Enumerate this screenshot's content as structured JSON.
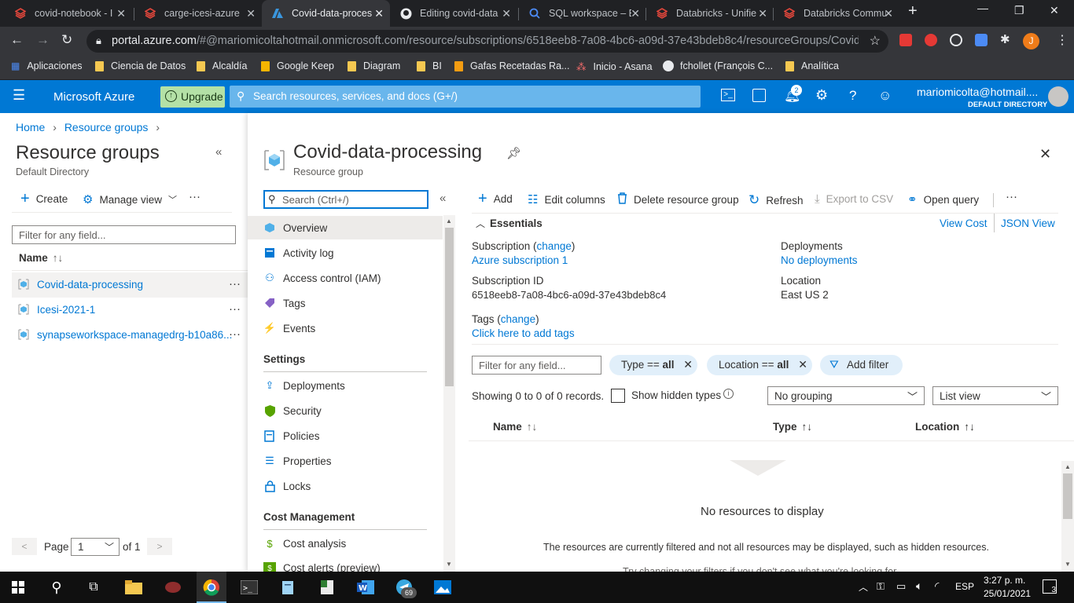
{
  "browser": {
    "tabs": [
      {
        "title": "covid-notebook - I",
        "color": "#e0463b"
      },
      {
        "title": "carge-icesi-azure",
        "color": "#e0463b"
      },
      {
        "title": "Covid-data-proces",
        "color": "#0078d4"
      },
      {
        "title": "Editing covid-data",
        "color": "#ffffff"
      },
      {
        "title": "SQL workspace – E",
        "color": "#4c8bf5"
      },
      {
        "title": "Databricks - Unifie",
        "color": "#e0463b"
      },
      {
        "title": "Databricks Commu",
        "color": "#e0463b"
      }
    ],
    "new_tab": "+",
    "url_host": "portal.azure.com",
    "url_path": "/#@mariomicoltahotmail.onmicrosoft.com/resource/subscriptions/6518eeb8-7a08-4bc6-a09d-37e43bdeb8c4/resourceGroups/Covid-d...",
    "profile_initial": "J",
    "bookmarks": [
      "Aplicaciones",
      "Ciencia de Datos",
      "Alcaldía",
      "Google Keep",
      "Diagram",
      "BI",
      "Gafas Recetadas Ra...",
      "Inicio - Asana",
      "fchollet (François C...",
      "Analítica"
    ]
  },
  "azure": {
    "brand": "Microsoft Azure",
    "upgrade": "Upgrade",
    "search_placeholder": "Search resources, services, and docs (G+/)",
    "notif_count": "2",
    "user": "mariomicolta@hotmail....",
    "directory": "DEFAULT DIRECTORY"
  },
  "breadcrumb": [
    "Home",
    "Resource groups"
  ],
  "left": {
    "title": "Resource groups",
    "subtitle": "Default Directory",
    "create": "Create",
    "manage_view": "Manage view",
    "filter_placeholder": "Filter for any field...",
    "col_name": "Name",
    "groups": [
      "Covid-data-processing",
      "Icesi-2021-1",
      "synapseworkspace-managedrg-b10a86..."
    ],
    "page_label": "Page",
    "page_value": "1",
    "page_of": "of 1"
  },
  "blade": {
    "title": "Covid-data-processing",
    "subtitle": "Resource group",
    "search_placeholder": "Search (Ctrl+/)",
    "menu_top": [
      "Overview",
      "Activity log",
      "Access control (IAM)",
      "Tags",
      "Events"
    ],
    "settings_header": "Settings",
    "menu_settings": [
      "Deployments",
      "Security",
      "Policies",
      "Properties",
      "Locks"
    ],
    "cost_header": "Cost Management",
    "menu_cost": [
      "Cost analysis",
      "Cost alerts (preview)"
    ]
  },
  "toolbar": {
    "add": "Add",
    "edit_columns": "Edit columns",
    "delete": "Delete resource group",
    "refresh": "Refresh",
    "export": "Export to CSV",
    "open_query": "Open query",
    "more": "···"
  },
  "essentials": {
    "header": "Essentials",
    "view_cost": "View Cost",
    "json_view": "JSON View",
    "subscription_label": "Subscription",
    "change": "change",
    "subscription_value": "Azure subscription 1",
    "subscription_id_label": "Subscription ID",
    "subscription_id": "6518eeb8-7a08-4bc6-a09d-37e43bdeb8c4",
    "tags_label": "Tags",
    "tags_value": "Click here to add tags",
    "deployments_label": "Deployments",
    "deployments_value": "No deployments",
    "location_label": "Location",
    "location_value": "East US 2"
  },
  "resources": {
    "filter_placeholder": "Filter for any field...",
    "type_filter_pre": "Type == ",
    "type_filter_val": "all",
    "location_filter_pre": "Location == ",
    "location_filter_val": "all",
    "add_filter": "Add filter",
    "showing": "Showing 0 to 0 of 0 records.",
    "show_hidden": "Show hidden types",
    "grouping": "No grouping",
    "view": "List view",
    "col_name": "Name",
    "col_type": "Type",
    "col_location": "Location",
    "empty": "No resources to display",
    "note": "The resources are currently filtered and not all resources may be displayed, such as hidden resources.",
    "note2": "Try changing your filters if you don't see what you're looking for."
  },
  "taskbar": {
    "telegram_badge": "69",
    "lang": "ESP",
    "time": "3:27 p. m.",
    "date": "25/01/2021",
    "notif": "3"
  }
}
